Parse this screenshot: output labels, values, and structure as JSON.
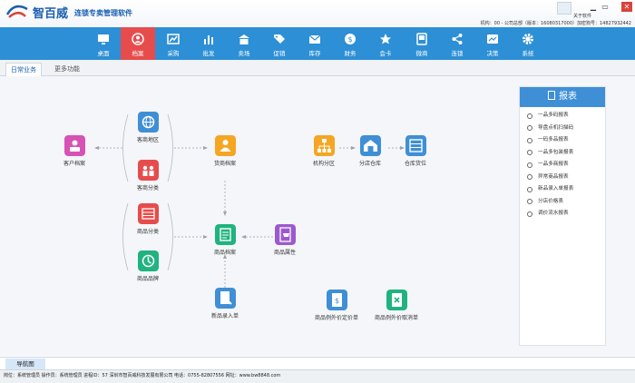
{
  "window": {
    "app_name": "智百威",
    "app_subtitle": "连锁专卖管理软件",
    "about_label": "关于软件",
    "machine_info": "机构：00 - 公司总部（版本：16080317000）加密狗号：14827932442",
    "controls": {
      "minimize": "▁",
      "restore": "▭",
      "close": "✕"
    }
  },
  "nav": [
    {
      "label": "桌面",
      "icon": "desktop-icon"
    },
    {
      "label": "档案",
      "icon": "archive-icon",
      "active": true
    },
    {
      "label": "采购",
      "icon": "purchase-icon"
    },
    {
      "label": "批发",
      "icon": "wholesale-icon"
    },
    {
      "label": "卖场",
      "icon": "store-icon"
    },
    {
      "label": "促销",
      "icon": "promotion-icon"
    },
    {
      "label": "库存",
      "icon": "inventory-icon"
    },
    {
      "label": "财务",
      "icon": "finance-icon"
    },
    {
      "label": "会卡",
      "icon": "member-card-icon"
    },
    {
      "label": "微商",
      "icon": "wechat-shop-icon"
    },
    {
      "label": "连锁",
      "icon": "chain-icon"
    },
    {
      "label": "决策",
      "icon": "decision-icon"
    },
    {
      "label": "系统",
      "icon": "system-icon"
    }
  ],
  "tabs": {
    "daily": "日常业务",
    "more": "更多功能"
  },
  "flow": {
    "customer_archive": "客户档案",
    "customer_region": "客商地区",
    "customer_category": "客商分类",
    "product_category": "商品分类",
    "product_brand": "商品品牌",
    "supplier_archive": "货商档案",
    "product_archive": "商品档案",
    "product_attribute": "商品属性",
    "new_product_entry": "新品录入单",
    "org_branch": "机构分区",
    "branch_warehouse": "分店仓库",
    "warehouse_location": "仓库货位",
    "price_exception": "商品例外价定价单",
    "price_exception_cancel": "商品例外价取消单"
  },
  "colors": {
    "nav_bg": "#2d8fd5",
    "nav_active": "#e74c4c",
    "accent": "#1a5fb0"
  },
  "reports": {
    "title": "报表",
    "items": [
      "一品多码报表",
      "导盘点机扫描码",
      "一码多品报表",
      "一品多包装报表",
      "一品多商报表",
      "异常商品报表",
      "新品录入单报表",
      "分店价格表",
      "调价流水报表"
    ]
  },
  "navmap_label": "导航图",
  "status": {
    "text": "岗位：系统管理员  操作员：系统管理员  进程ID：57  深圳市智百威科技发展有限公司 电话：0755-82807556 网址：www.bw8848.com"
  }
}
